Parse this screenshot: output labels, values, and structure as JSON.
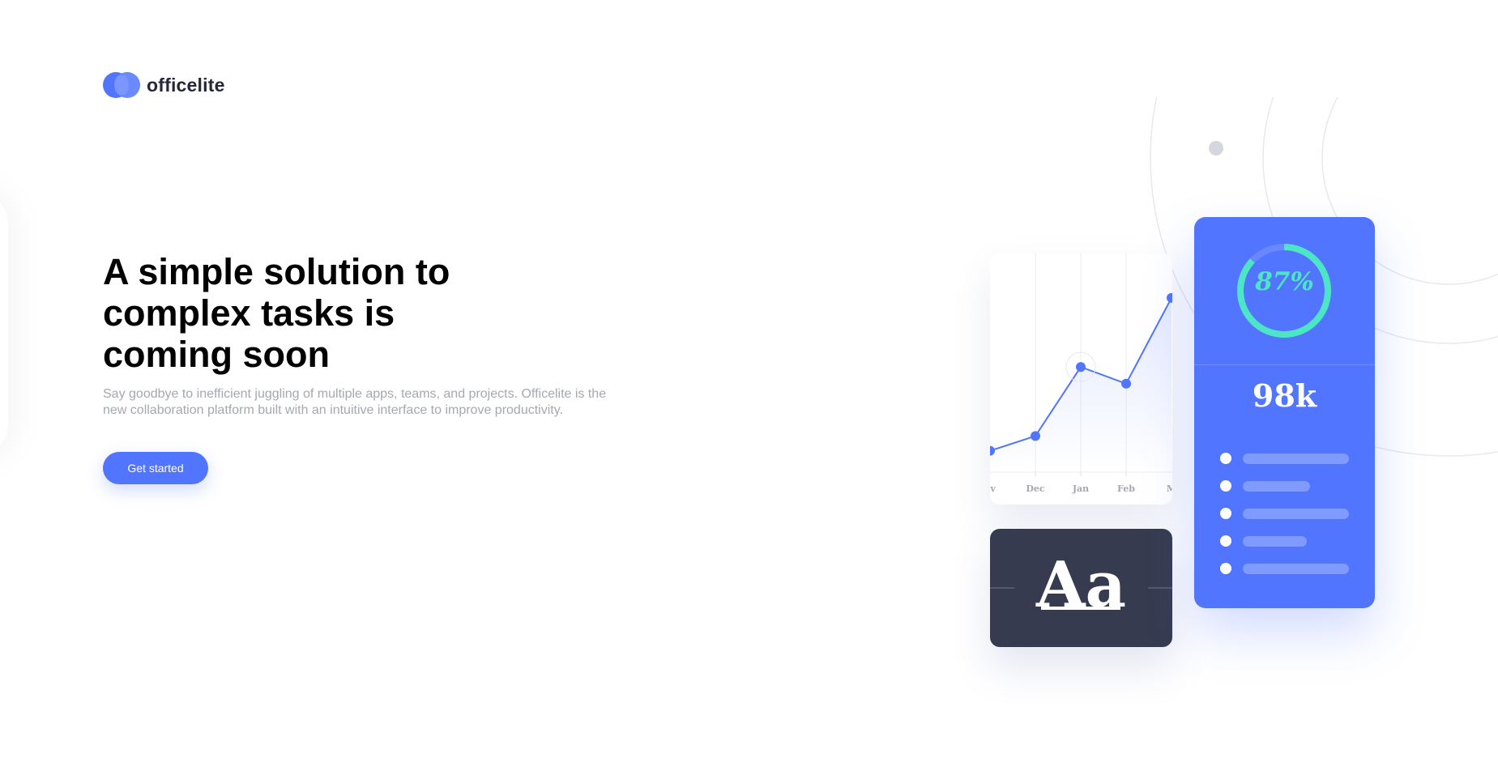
{
  "brand": {
    "name": "officelite",
    "accent_color": "#5175FF"
  },
  "hero": {
    "title": "A simple solution to complex tasks is coming soon",
    "description": "Say goodbye to inefficient juggling of multiple apps, teams, and projects. Officelite is the new collaboration platform built with an intuitive interface to improve productivity.",
    "cta_label": "Get started"
  },
  "chart_data": {
    "type": "line",
    "categories": [
      "Nov",
      "Dec",
      "Jan",
      "Feb",
      "Mar"
    ],
    "tick_labels": [
      "ov",
      "Dec",
      "Jan",
      "Feb",
      "M"
    ],
    "values": [
      20,
      35,
      105,
      88,
      175
    ],
    "ylim": [
      0,
      220
    ],
    "title": "",
    "xlabel": "",
    "ylabel": "",
    "grid": true,
    "highlight_index": 2,
    "color": "#5175FF"
  },
  "font_card": {
    "sample": "Aa"
  },
  "stats_card": {
    "progress_percent": 87,
    "progress_label": "87%",
    "progress_color": "#4CE6C6",
    "big_number": "98k",
    "list_bar_fractions": [
      1.0,
      0.63,
      1.0,
      0.6,
      1.0
    ]
  }
}
